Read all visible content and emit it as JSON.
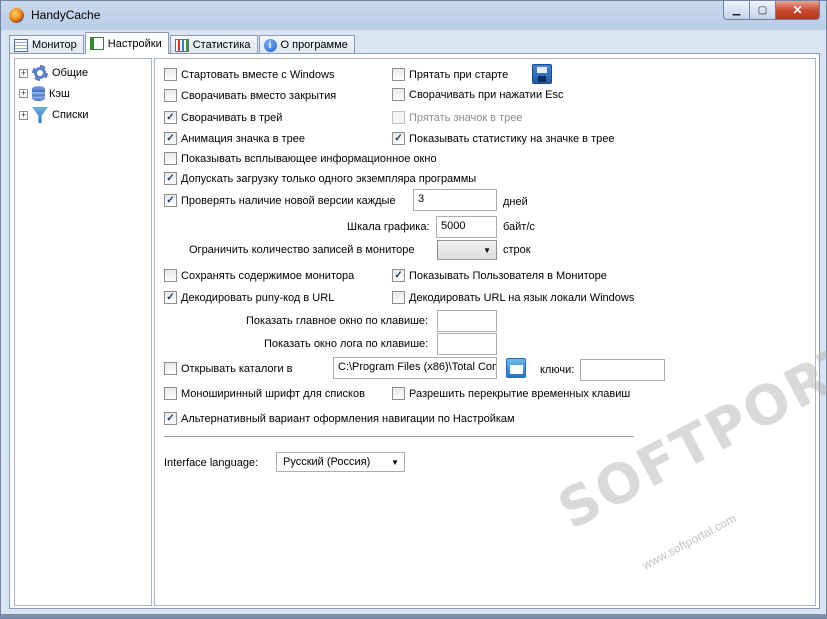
{
  "window": {
    "title": "HandyCache"
  },
  "tabs": [
    {
      "label": "Монитор",
      "icon": "grid-icon"
    },
    {
      "label": "Настройки",
      "icon": "settings-form-icon"
    },
    {
      "label": "Статистика",
      "icon": "statistics-icon"
    },
    {
      "label": "О программе",
      "icon": "info-icon"
    }
  ],
  "active_tab": "Настройки",
  "tree": [
    {
      "label": "Общие",
      "icon": "gear-icon"
    },
    {
      "label": "Кэш",
      "icon": "database-icon"
    },
    {
      "label": "Списки",
      "icon": "funnel-icon"
    }
  ],
  "settings": {
    "start_with_windows": {
      "label": "Стартовать вместе с Windows",
      "checked": false
    },
    "hide_on_start": {
      "label": "Прятать при старте",
      "checked": false
    },
    "minimize_instead_close": {
      "label": "Сворачивать вместо закрытия",
      "checked": false
    },
    "minimize_on_esc": {
      "label": "Сворачивать при нажатии Esc",
      "checked": false
    },
    "minimize_to_tray": {
      "label": "Сворачивать в трей",
      "checked": true
    },
    "hide_tray_icon": {
      "label": "Прятать значок в трее",
      "checked": false,
      "disabled": true
    },
    "tray_icon_animation": {
      "label": "Анимация значка в трее",
      "checked": true
    },
    "show_tray_stats": {
      "label": "Показывать статистику на значке в трее",
      "checked": true
    },
    "show_popup": {
      "label": "Показывать всплывающее информационное окно",
      "checked": false
    },
    "single_instance": {
      "label": "Допускать загрузку только одного экземпляра программы",
      "checked": true
    },
    "check_updates": {
      "label": "Проверять наличие новой версии каждые",
      "checked": true,
      "value": "3",
      "unit": "дней"
    },
    "graph_scale": {
      "label": "Шкала графика:",
      "value": "5000",
      "unit": "байт/с"
    },
    "monitor_limit": {
      "label": "Ограничить  количество  записей в мониторе",
      "value": "",
      "unit": "строк"
    },
    "save_monitor": {
      "label": "Сохранять содержимое монитора",
      "checked": false
    },
    "show_user_in_monitor": {
      "label": "Показывать Пользователя в Мониторе",
      "checked": true
    },
    "decode_punycode": {
      "label": "Декодировать puny-код в URL",
      "checked": true
    },
    "decode_url_locale": {
      "label": "Декодировать URL на язык локали Windows",
      "checked": false
    },
    "hotkey_main": {
      "label": "Показать главное окно по клавише:",
      "value": ""
    },
    "hotkey_log": {
      "label": "Показать окно лога по клавише:",
      "value": ""
    },
    "open_folders": {
      "label": "Открывать каталоги в",
      "checked": false,
      "path": "C:\\Program Files (x86)\\Total Com",
      "keys_label": "ключи:",
      "keys_value": ""
    },
    "monospace_lists": {
      "label": "Моноширинный шрифт для списков",
      "checked": false
    },
    "allow_temp_keys": {
      "label": "Разрешить перекрытие временных клавиш",
      "checked": false
    },
    "alt_navigation": {
      "label": "Альтернативный вариант оформления навигации по Настройкам",
      "checked": true
    },
    "interface_language": {
      "label": "Interface language:",
      "value": "Русский (Россия)"
    }
  },
  "watermark": {
    "text": "SOFTPORTAL",
    "sub": "www.softportal.com"
  }
}
